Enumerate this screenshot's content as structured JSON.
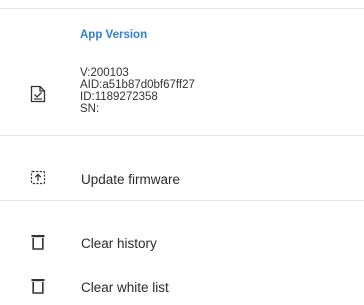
{
  "app_version": {
    "title": "App Version",
    "version": "V:200103",
    "aid": "AID:a51b87d0bf67ff27",
    "id": "ID:1189272358",
    "sn": "SN:",
    "icon": "document-check-icon"
  },
  "actions": {
    "update_firmware": {
      "label": "Update firmware",
      "icon": "upload-icon"
    },
    "clear_history": {
      "label": "Clear history",
      "icon": "trash-icon"
    },
    "clear_white_list": {
      "label": "Clear white list",
      "icon": "trash-icon"
    }
  }
}
